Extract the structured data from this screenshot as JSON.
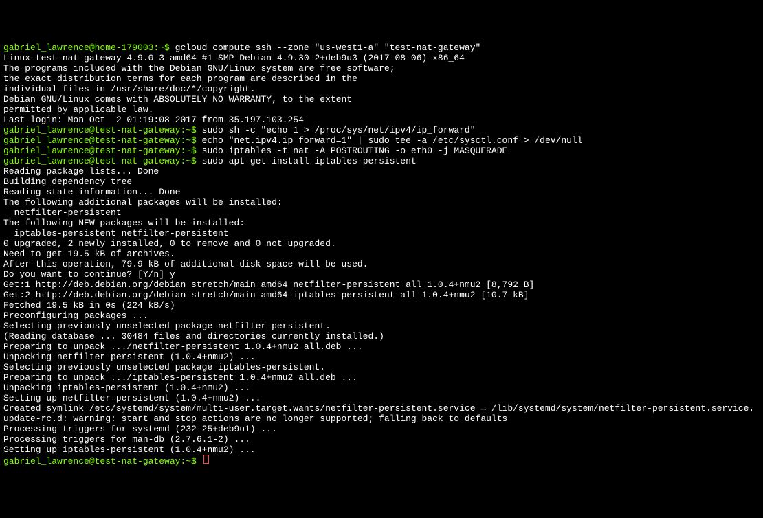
{
  "lines": [
    {
      "segments": [
        {
          "text": "gabriel_lawrence@home-179003:~$ ",
          "class": "green"
        },
        {
          "text": "gcloud compute ssh --zone \"us-west1-a\" \"test-nat-gateway\""
        }
      ]
    },
    {
      "segments": [
        {
          "text": "Linux test-nat-gateway 4.9.0-3-amd64 #1 SMP Debian 4.9.30-2+deb9u3 (2017-08-06) x86_64"
        }
      ]
    },
    {
      "segments": [
        {
          "text": ""
        }
      ]
    },
    {
      "segments": [
        {
          "text": "The programs included with the Debian GNU/Linux system are free software;"
        }
      ]
    },
    {
      "segments": [
        {
          "text": "the exact distribution terms for each program are described in the"
        }
      ]
    },
    {
      "segments": [
        {
          "text": "individual files in /usr/share/doc/*/copyright."
        }
      ]
    },
    {
      "segments": [
        {
          "text": ""
        }
      ]
    },
    {
      "segments": [
        {
          "text": "Debian GNU/Linux comes with ABSOLUTELY NO WARRANTY, to the extent"
        }
      ]
    },
    {
      "segments": [
        {
          "text": "permitted by applicable law."
        }
      ]
    },
    {
      "segments": [
        {
          "text": "Last login: Mon Oct  2 01:19:08 2017 from 35.197.103.254"
        }
      ]
    },
    {
      "segments": [
        {
          "text": "gabriel_lawrence@test-nat-gateway:~$ ",
          "class": "green"
        },
        {
          "text": "sudo sh -c \"echo 1 > /proc/sys/net/ipv4/ip_forward\""
        }
      ]
    },
    {
      "segments": [
        {
          "text": "gabriel_lawrence@test-nat-gateway:~$ ",
          "class": "green"
        },
        {
          "text": "echo \"net.ipv4.ip_forward=1\" | sudo tee -a /etc/sysctl.conf > /dev/null"
        }
      ]
    },
    {
      "segments": [
        {
          "text": "gabriel_lawrence@test-nat-gateway:~$ ",
          "class": "green"
        },
        {
          "text": "sudo iptables -t nat -A POSTROUTING -o eth0 -j MASQUERADE"
        }
      ]
    },
    {
      "segments": [
        {
          "text": "gabriel_lawrence@test-nat-gateway:~$ ",
          "class": "green"
        },
        {
          "text": "sudo apt-get install iptables-persistent"
        }
      ]
    },
    {
      "segments": [
        {
          "text": "Reading package lists... Done"
        }
      ]
    },
    {
      "segments": [
        {
          "text": "Building dependency tree"
        }
      ]
    },
    {
      "segments": [
        {
          "text": "Reading state information... Done"
        }
      ]
    },
    {
      "segments": [
        {
          "text": "The following additional packages will be installed:"
        }
      ]
    },
    {
      "segments": [
        {
          "text": "  netfilter-persistent"
        }
      ]
    },
    {
      "segments": [
        {
          "text": "The following NEW packages will be installed:"
        }
      ]
    },
    {
      "segments": [
        {
          "text": "  iptables-persistent netfilter-persistent"
        }
      ]
    },
    {
      "segments": [
        {
          "text": "0 upgraded, 2 newly installed, 0 to remove and 0 not upgraded."
        }
      ]
    },
    {
      "segments": [
        {
          "text": "Need to get 19.5 kB of archives."
        }
      ]
    },
    {
      "segments": [
        {
          "text": "After this operation, 79.9 kB of additional disk space will be used."
        }
      ]
    },
    {
      "segments": [
        {
          "text": "Do you want to continue? [Y/n] y"
        }
      ]
    },
    {
      "segments": [
        {
          "text": "Get:1 http://deb.debian.org/debian stretch/main amd64 netfilter-persistent all 1.0.4+nmu2 [8,792 B]"
        }
      ]
    },
    {
      "segments": [
        {
          "text": "Get:2 http://deb.debian.org/debian stretch/main amd64 iptables-persistent all 1.0.4+nmu2 [10.7 kB]"
        }
      ]
    },
    {
      "segments": [
        {
          "text": "Fetched 19.5 kB in 0s (224 kB/s)"
        }
      ]
    },
    {
      "segments": [
        {
          "text": "Preconfiguring packages ..."
        }
      ]
    },
    {
      "segments": [
        {
          "text": "Selecting previously unselected package netfilter-persistent."
        }
      ]
    },
    {
      "segments": [
        {
          "text": "(Reading database ... 30484 files and directories currently installed.)"
        }
      ]
    },
    {
      "segments": [
        {
          "text": "Preparing to unpack .../netfilter-persistent_1.0.4+nmu2_all.deb ..."
        }
      ]
    },
    {
      "segments": [
        {
          "text": "Unpacking netfilter-persistent (1.0.4+nmu2) ..."
        }
      ]
    },
    {
      "segments": [
        {
          "text": "Selecting previously unselected package iptables-persistent."
        }
      ]
    },
    {
      "segments": [
        {
          "text": "Preparing to unpack .../iptables-persistent_1.0.4+nmu2_all.deb ..."
        }
      ]
    },
    {
      "segments": [
        {
          "text": "Unpacking iptables-persistent (1.0.4+nmu2) ..."
        }
      ]
    },
    {
      "segments": [
        {
          "text": "Setting up netfilter-persistent (1.0.4+nmu2) ..."
        }
      ]
    },
    {
      "segments": [
        {
          "text": "Created symlink /etc/systemd/system/multi-user.target.wants/netfilter-persistent.service → /lib/systemd/system/netfilter-persistent.service."
        }
      ]
    },
    {
      "segments": [
        {
          "text": "update-rc.d: warning: start and stop actions are no longer supported; falling back to defaults"
        }
      ]
    },
    {
      "segments": [
        {
          "text": "Processing triggers for systemd (232-25+deb9u1) ..."
        }
      ]
    },
    {
      "segments": [
        {
          "text": "Processing triggers for man-db (2.7.6.1-2) ..."
        }
      ]
    },
    {
      "segments": [
        {
          "text": "Setting up iptables-persistent (1.0.4+nmu2) ..."
        }
      ]
    },
    {
      "segments": [
        {
          "text": "gabriel_lawrence@test-nat-gateway:~$ ",
          "class": "green"
        }
      ],
      "cursor": true
    }
  ]
}
